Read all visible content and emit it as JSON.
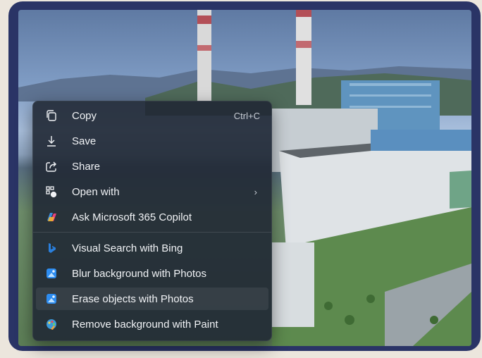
{
  "menu": {
    "items": [
      {
        "label": "Copy",
        "shortcut": "Ctrl+C",
        "icon": "copy-icon"
      },
      {
        "label": "Save",
        "icon": "download-icon"
      },
      {
        "label": "Share",
        "icon": "share-icon"
      },
      {
        "label": "Open with",
        "submenu_glyph": "›",
        "icon": "open-with-icon"
      },
      {
        "label": "Ask Microsoft 365 Copilot",
        "icon": "copilot-icon"
      },
      {
        "label": "Visual Search with Bing",
        "icon": "bing-icon"
      },
      {
        "label": "Blur background with Photos",
        "icon": "photos-icon"
      },
      {
        "label": "Erase objects with Photos",
        "icon": "photos-icon"
      },
      {
        "label": "Remove background with Paint",
        "icon": "paint-icon"
      }
    ]
  },
  "colors": {
    "frame": "#2a3466",
    "menu_bg": "#202834",
    "menu_text": "#f1f3f6",
    "photos_blue": "#2d8cf0",
    "bing_blue": "#2a7fdc"
  }
}
